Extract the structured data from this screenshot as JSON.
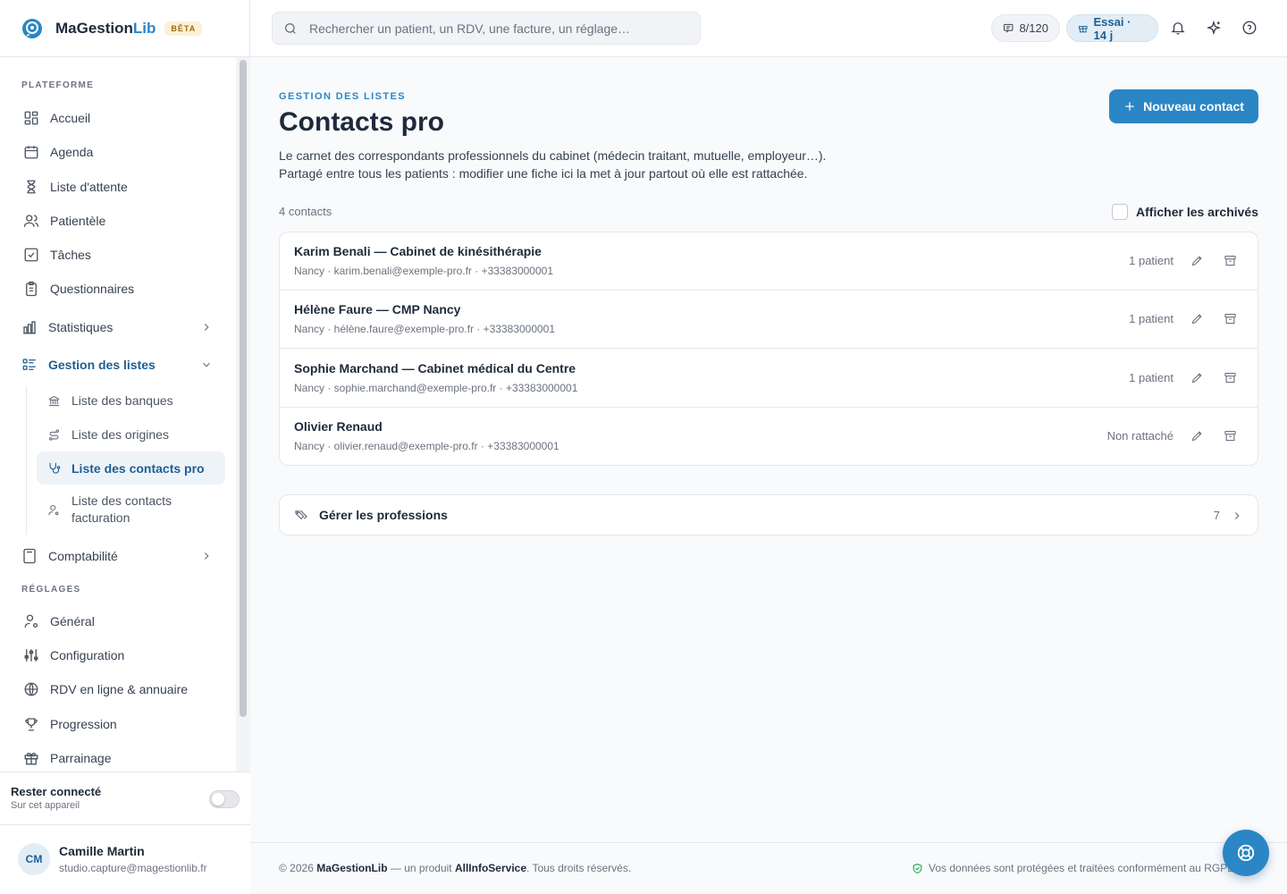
{
  "app": {
    "name_part1": "MaGestion",
    "name_part2": "Lib",
    "badge": "BÊTA"
  },
  "search": {
    "placeholder": "Rechercher un patient, un RDV, une facture, un réglage…"
  },
  "topbar": {
    "quota": "8/120",
    "trial": "Essai · 14 j"
  },
  "sidebar": {
    "section_platform": "PLATEFORME",
    "section_settings": "RÉGLAGES",
    "items": {
      "accueil": "Accueil",
      "agenda": "Agenda",
      "attente": "Liste d'attente",
      "patientele": "Patientèle",
      "taches": "Tâches",
      "questionnaires": "Questionnaires",
      "statistiques": "Statistiques",
      "gestion": "Gestion des listes",
      "comptabilite": "Comptabilité",
      "general": "Général",
      "configuration": "Configuration",
      "rdv": "RDV en ligne & annuaire",
      "progression": "Progression",
      "parrainage": "Parrainage"
    },
    "subitems": {
      "banques": "Liste des banques",
      "origines": "Liste des origines",
      "contacts_pro": "Liste des contacts pro",
      "contacts_facturation": "Liste des contacts facturation"
    },
    "stay": {
      "title": "Rester connecté",
      "subtitle": "Sur cet appareil"
    },
    "user": {
      "initials": "CM",
      "name": "Camille Martin",
      "email": "studio.capture@magestionlib.fr"
    }
  },
  "main": {
    "kicker": "GESTION DES LISTES",
    "title": "Contacts pro",
    "desc1": "Le carnet des correspondants professionnels du cabinet (médecin traitant, mutuelle, employeur…).",
    "desc2": "Partagé entre tous les patients : modifier une fiche ici la met à jour partout où elle est rattachée.",
    "new_button": "Nouveau contact",
    "count": "4 contacts",
    "archived_label": "Afficher les archivés",
    "contacts": [
      {
        "title": "Karim Benali — Cabinet de kinésithérapie",
        "sub": "Nancy · karim.benali@exemple-pro.fr · +33383000001",
        "badge": "1 patient"
      },
      {
        "title": "Hélène Faure — CMP Nancy",
        "sub": "Nancy · hélène.faure@exemple-pro.fr · +33383000001",
        "badge": "1 patient"
      },
      {
        "title": "Sophie Marchand — Cabinet médical du Centre",
        "sub": "Nancy · sophie.marchand@exemple-pro.fr · +33383000001",
        "badge": "1 patient"
      },
      {
        "title": "Olivier Renaud",
        "sub": "Nancy · olivier.renaud@exemple-pro.fr · +33383000001",
        "badge": "Non rattaché"
      }
    ],
    "professions": {
      "label": "Gérer les professions",
      "count": "7"
    }
  },
  "footer": {
    "copy_prefix": "© 2026",
    "brand": "MaGestionLib",
    "middle": "— un produit",
    "company": "AllInfoService",
    "suffix": ". Tous droits réservés.",
    "right": "Vos données sont protégées et traitées conformément au RGPD."
  },
  "colors": {
    "accent": "#2b86c5",
    "accent_dark": "#1d5f94",
    "beta_bg": "#fdf1d6"
  }
}
